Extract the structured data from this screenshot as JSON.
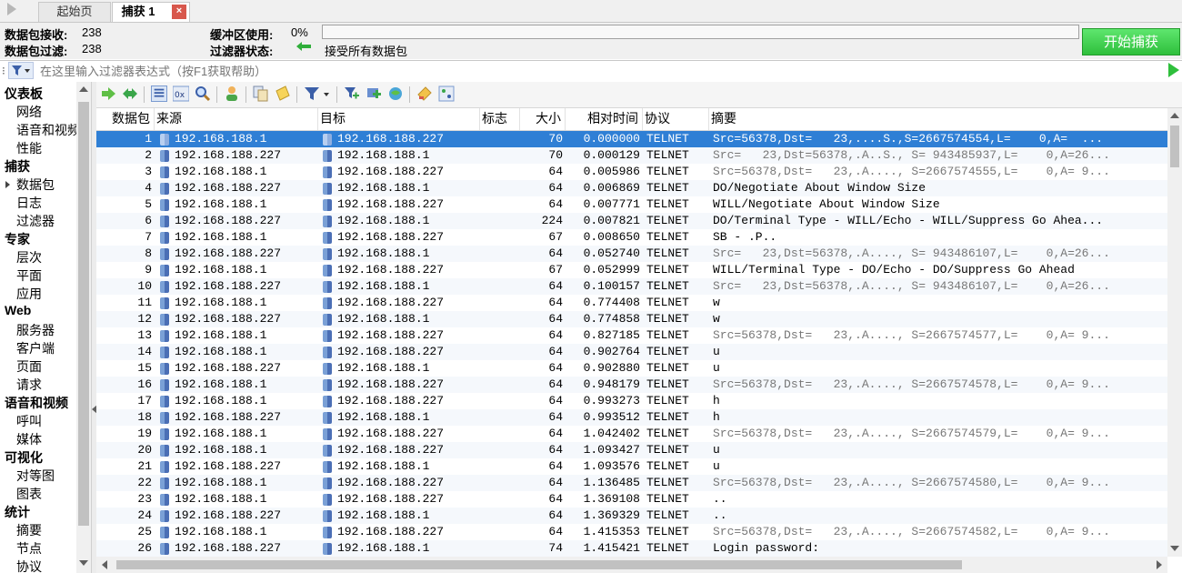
{
  "tabs": {
    "home": "起始页",
    "capture": "捕获 1",
    "close": "×"
  },
  "status": {
    "received_label": "数据包接收:",
    "received_value": "238",
    "filtered_label": "数据包过滤:",
    "filtered_value": "238",
    "buffer_label": "缓冲区使用:",
    "buffer_value": "0%",
    "buffer_fraction": 0,
    "filter_state_label": "过滤器状态:",
    "filter_state_value": "接受所有数据包",
    "start_button": "开始捕获"
  },
  "filter": {
    "placeholder": "在这里输入过滤器表达式（按F1获取帮助）"
  },
  "sidebar": {
    "categories": [
      {
        "label": "仪表板",
        "items": [
          "网络",
          "语音和视频",
          "性能"
        ]
      },
      {
        "label": "捕获",
        "items": [
          "数据包",
          "日志",
          "过滤器"
        ]
      },
      {
        "label": "专家",
        "items": [
          "层次",
          "平面",
          "应用"
        ]
      },
      {
        "label": "Web",
        "items": [
          "服务器",
          "客户端",
          "页面",
          "请求"
        ]
      },
      {
        "label": "语音和视频",
        "items": [
          "呼叫",
          "媒体"
        ]
      },
      {
        "label": "可视化",
        "items": [
          "对等图",
          "图表"
        ]
      },
      {
        "label": "统计",
        "items": [
          "摘要",
          "节点",
          "协议"
        ]
      }
    ],
    "selected_item": "数据包"
  },
  "colors": {
    "selected_row": "#2f7fd5",
    "start_button": "#2fbf3c"
  },
  "table": {
    "headers": {
      "num": "数据包",
      "src": "来源",
      "dst": "目标",
      "flag": "标志",
      "size": "大小",
      "time": "相对时间",
      "proto": "协议",
      "summary": "摘要"
    },
    "rows": [
      {
        "num": "1",
        "src": "192.168.188.1",
        "dst": "192.168.188.227",
        "size": "70",
        "time": "0.000000",
        "proto": "TELNET",
        "summary": "Src=56378,Dst=   23,....S.,S=2667574554,L=    0,A=  ...",
        "gray": true
      },
      {
        "num": "2",
        "src": "192.168.188.227",
        "dst": "192.168.188.1",
        "size": "70",
        "time": "0.000129",
        "proto": "TELNET",
        "summary": "Src=   23,Dst=56378,.A..S., S= 943485937,L=    0,A=26...",
        "gray": true
      },
      {
        "num": "3",
        "src": "192.168.188.1",
        "dst": "192.168.188.227",
        "size": "64",
        "time": "0.005986",
        "proto": "TELNET",
        "summary": "Src=56378,Dst=   23,.A...., S=2667574555,L=    0,A= 9...",
        "gray": true
      },
      {
        "num": "4",
        "src": "192.168.188.227",
        "dst": "192.168.188.1",
        "size": "64",
        "time": "0.006869",
        "proto": "TELNET",
        "summary": "DO/Negotiate About Window Size",
        "gray": false
      },
      {
        "num": "5",
        "src": "192.168.188.1",
        "dst": "192.168.188.227",
        "size": "64",
        "time": "0.007771",
        "proto": "TELNET",
        "summary": "WILL/Negotiate About Window Size",
        "gray": false
      },
      {
        "num": "6",
        "src": "192.168.188.227",
        "dst": "192.168.188.1",
        "size": "224",
        "time": "0.007821",
        "proto": "TELNET",
        "summary": "DO/Terminal Type - WILL/Echo - WILL/Suppress Go Ahea...",
        "gray": false
      },
      {
        "num": "7",
        "src": "192.168.188.1",
        "dst": "192.168.188.227",
        "size": "67",
        "time": "0.008650",
        "proto": "TELNET",
        "summary": "SB - .P..",
        "gray": false
      },
      {
        "num": "8",
        "src": "192.168.188.227",
        "dst": "192.168.188.1",
        "size": "64",
        "time": "0.052740",
        "proto": "TELNET",
        "summary": "Src=   23,Dst=56378,.A...., S= 943486107,L=    0,A=26...",
        "gray": true
      },
      {
        "num": "9",
        "src": "192.168.188.1",
        "dst": "192.168.188.227",
        "size": "67",
        "time": "0.052999",
        "proto": "TELNET",
        "summary": "WILL/Terminal Type - DO/Echo - DO/Suppress Go Ahead",
        "gray": false
      },
      {
        "num": "10",
        "src": "192.168.188.227",
        "dst": "192.168.188.1",
        "size": "64",
        "time": "0.100157",
        "proto": "TELNET",
        "summary": "Src=   23,Dst=56378,.A...., S= 943486107,L=    0,A=26...",
        "gray": true
      },
      {
        "num": "11",
        "src": "192.168.188.1",
        "dst": "192.168.188.227",
        "size": "64",
        "time": "0.774408",
        "proto": "TELNET",
        "summary": "w",
        "gray": false
      },
      {
        "num": "12",
        "src": "192.168.188.227",
        "dst": "192.168.188.1",
        "size": "64",
        "time": "0.774858",
        "proto": "TELNET",
        "summary": "w",
        "gray": false
      },
      {
        "num": "13",
        "src": "192.168.188.1",
        "dst": "192.168.188.227",
        "size": "64",
        "time": "0.827185",
        "proto": "TELNET",
        "summary": "Src=56378,Dst=   23,.A...., S=2667574577,L=    0,A= 9...",
        "gray": true
      },
      {
        "num": "14",
        "src": "192.168.188.1",
        "dst": "192.168.188.227",
        "size": "64",
        "time": "0.902764",
        "proto": "TELNET",
        "summary": "u",
        "gray": false
      },
      {
        "num": "15",
        "src": "192.168.188.227",
        "dst": "192.168.188.1",
        "size": "64",
        "time": "0.902880",
        "proto": "TELNET",
        "summary": "u",
        "gray": false
      },
      {
        "num": "16",
        "src": "192.168.188.1",
        "dst": "192.168.188.227",
        "size": "64",
        "time": "0.948179",
        "proto": "TELNET",
        "summary": "Src=56378,Dst=   23,.A...., S=2667574578,L=    0,A= 9...",
        "gray": true
      },
      {
        "num": "17",
        "src": "192.168.188.1",
        "dst": "192.168.188.227",
        "size": "64",
        "time": "0.993273",
        "proto": "TELNET",
        "summary": "h",
        "gray": false
      },
      {
        "num": "18",
        "src": "192.168.188.227",
        "dst": "192.168.188.1",
        "size": "64",
        "time": "0.993512",
        "proto": "TELNET",
        "summary": "h",
        "gray": false
      },
      {
        "num": "19",
        "src": "192.168.188.1",
        "dst": "192.168.188.227",
        "size": "64",
        "time": "1.042402",
        "proto": "TELNET",
        "summary": "Src=56378,Dst=   23,.A...., S=2667574579,L=    0,A= 9...",
        "gray": true
      },
      {
        "num": "20",
        "src": "192.168.188.1",
        "dst": "192.168.188.227",
        "size": "64",
        "time": "1.093427",
        "proto": "TELNET",
        "summary": "u",
        "gray": false
      },
      {
        "num": "21",
        "src": "192.168.188.227",
        "dst": "192.168.188.1",
        "size": "64",
        "time": "1.093576",
        "proto": "TELNET",
        "summary": "u",
        "gray": false
      },
      {
        "num": "22",
        "src": "192.168.188.1",
        "dst": "192.168.188.227",
        "size": "64",
        "time": "1.136485",
        "proto": "TELNET",
        "summary": "Src=56378,Dst=   23,.A...., S=2667574580,L=    0,A= 9...",
        "gray": true
      },
      {
        "num": "23",
        "src": "192.168.188.1",
        "dst": "192.168.188.227",
        "size": "64",
        "time": "1.369108",
        "proto": "TELNET",
        "summary": "..",
        "gray": false
      },
      {
        "num": "24",
        "src": "192.168.188.227",
        "dst": "192.168.188.1",
        "size": "64",
        "time": "1.369329",
        "proto": "TELNET",
        "summary": "..",
        "gray": false
      },
      {
        "num": "25",
        "src": "192.168.188.1",
        "dst": "192.168.188.227",
        "size": "64",
        "time": "1.415353",
        "proto": "TELNET",
        "summary": "Src=56378,Dst=   23,.A...., S=2667574582,L=    0,A= 9...",
        "gray": true
      },
      {
        "num": "26",
        "src": "192.168.188.227",
        "dst": "192.168.188.1",
        "size": "74",
        "time": "1.415421",
        "proto": "TELNET",
        "summary": "Login password:",
        "gray": false
      }
    ]
  }
}
